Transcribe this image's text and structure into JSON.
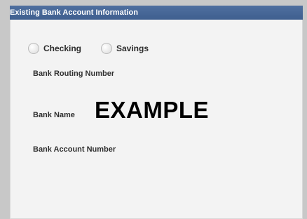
{
  "header": {
    "title": "Existing Bank Account Information"
  },
  "account_type": {
    "options": [
      {
        "label": "Checking",
        "selected": false
      },
      {
        "label": "Savings",
        "selected": false
      }
    ]
  },
  "fields": {
    "routing_label": "Bank Routing Number",
    "bank_name_label": "Bank Name",
    "account_number_label": "Bank Account Number"
  },
  "overlay": {
    "text": "EXAMPLE"
  },
  "colors": {
    "header_bg": "#4a6a9a",
    "panel_bg": "#f3f3f3",
    "outer_bg": "#c8c8c8"
  }
}
